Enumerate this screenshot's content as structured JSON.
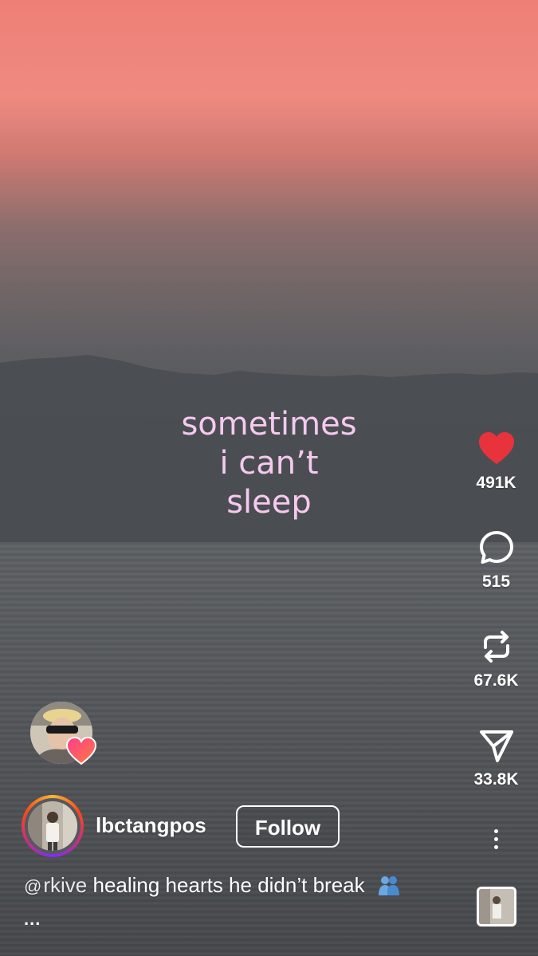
{
  "overlay_text": [
    "sometimes",
    "i can’t",
    "sleep"
  ],
  "actions": {
    "like_count": "491K",
    "comment_count": "515",
    "repost_count": "67.6K",
    "share_count": "33.8K"
  },
  "author": {
    "username": "lbctangpos",
    "follow_label": "Follow"
  },
  "caption": {
    "mention_icon": "threads-icon",
    "mention": "rkive",
    "text": "healing hearts he didn’t break",
    "emoji": "people-hugging-emoji",
    "more_label": "..."
  },
  "colors": {
    "like_heart": "#e8323c",
    "overlay_text": "#f6c9ef",
    "sky_top": "#ee7f76"
  },
  "icons": [
    "heart-icon",
    "comment-icon",
    "repost-icon",
    "share-icon",
    "more-options-icon",
    "audio-thumbnail"
  ]
}
